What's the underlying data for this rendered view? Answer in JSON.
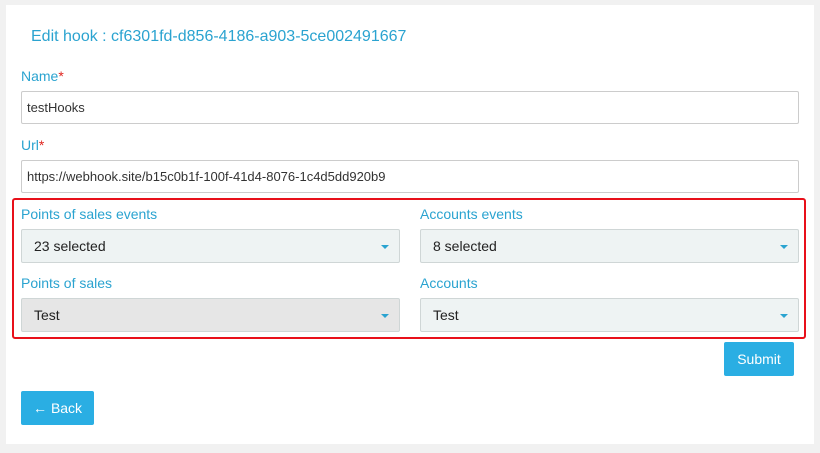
{
  "page": {
    "title": "Edit hook : cf6301fd-d856-4186-a903-5ce002491667"
  },
  "form": {
    "name": {
      "label": "Name",
      "required_mark": "*",
      "value": "testHooks"
    },
    "url": {
      "label": "Url",
      "required_mark": "*",
      "value": "https://webhook.site/b15c0b1f-100f-41d4-8076-1c4d5dd920b9"
    },
    "pos_events": {
      "label": "Points of sales events",
      "value": "23 selected"
    },
    "account_events": {
      "label": "Accounts events",
      "value": "8 selected"
    },
    "pos": {
      "label": "Points of sales",
      "value": "Test"
    },
    "accounts": {
      "label": "Accounts",
      "value": "Test"
    }
  },
  "actions": {
    "submit_label": "Submit",
    "back_label": "Back"
  },
  "colors": {
    "accent": "#2aa3d0",
    "button": "#2aaee3",
    "highlight_border": "#e8101a",
    "required": "#e0251f"
  }
}
